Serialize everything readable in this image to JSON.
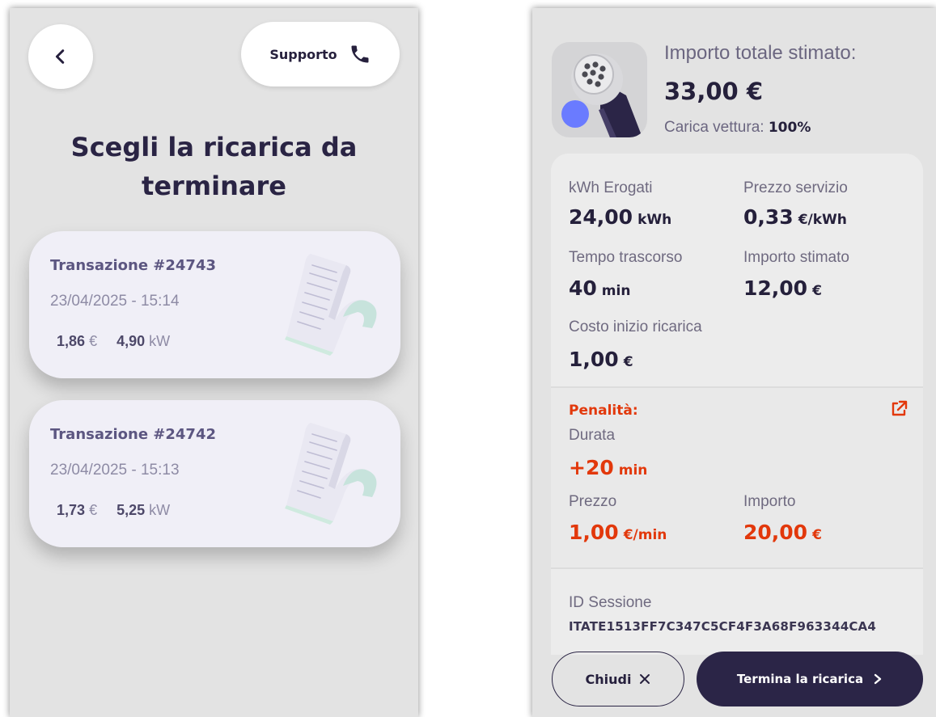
{
  "left": {
    "support_label": "Supporto",
    "title_line1": "Scegli la ricarica da",
    "title_line2": "terminare",
    "transactions": [
      {
        "title": "Transazione #24743",
        "datetime": "23/04/2025 - 15:14",
        "amount": "1,86",
        "amount_unit": "€",
        "power": "4,90",
        "power_unit": "kW"
      },
      {
        "title": "Transazione #24742",
        "datetime": "23/04/2025 - 15:13",
        "amount": "1,73",
        "amount_unit": "€",
        "power": "5,25",
        "power_unit": "kW"
      }
    ]
  },
  "right": {
    "estimated_total_label": "Importo totale stimato:",
    "estimated_total_value": "33,00 €",
    "charge_label": "Carica vettura:",
    "charge_value": "100%",
    "kwh_label": "kWh Erogati",
    "kwh_value": "24,00",
    "kwh_unit": "kWh",
    "service_price_label": "Prezzo servizio",
    "service_price_value": "0,33",
    "service_price_unit": "€/kWh",
    "elapsed_label": "Tempo trascorso",
    "elapsed_value": "40",
    "elapsed_unit": "min",
    "estimated_amount_label": "Importo stimato",
    "estimated_amount_value": "12,00",
    "estimated_amount_unit": "€",
    "start_cost_label": "Costo inizio ricarica",
    "start_cost_value": "1,00",
    "start_cost_unit": "€",
    "penalty": {
      "title": "Penalità:",
      "duration_label": "Durata",
      "duration_value": "+20",
      "duration_unit": "min",
      "price_label": "Prezzo",
      "price_value": "1,00",
      "price_unit": "€/min",
      "amount_label": "Importo",
      "amount_value": "20,00",
      "amount_unit": "€"
    },
    "session_id_label": "ID Sessione",
    "session_id_value": "ITATE1513FF7C347C5CF4F3A68F963344CA4",
    "close_label": "Chiudi",
    "end_label": "Termina la ricarica"
  },
  "colors": {
    "primary_dark": "#2b2547",
    "penalty_red": "#e2380b",
    "screen_bg": "#e3e3e3",
    "card_bg": "#f0eff7",
    "accent_blue": "#6a7bff"
  },
  "icons": [
    "chevron-left-icon",
    "phone-icon",
    "receipt-icon",
    "ev-plug-icon",
    "external-link-icon",
    "close-x-icon",
    "chevron-right-icon"
  ]
}
